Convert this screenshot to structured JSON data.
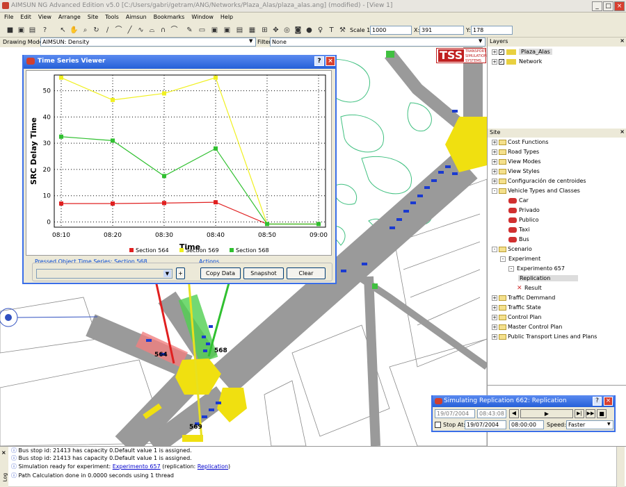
{
  "window": {
    "title": "AIMSUN NG Advanced Edition v5.0  [C:/Users/gabri/getram/ANG/Networks/Plaza_Alas/plaza_alas.ang] (modified) - [View 1]"
  },
  "menu": [
    "File",
    "Edit",
    "View",
    "Arrange",
    "Site",
    "Tools",
    "Aimsun",
    "Bookmarks",
    "Window",
    "Help"
  ],
  "toolbar": {
    "scale_label": "Scale 1:",
    "scale_value": "1000",
    "x_label": "X:",
    "x_value": "391",
    "y_label": "Y:",
    "y_value": "178"
  },
  "drawing_mode": {
    "label": "Drawing Mode:",
    "value": "AIMSUN: Density",
    "filter_label": "Filter:",
    "filter_value": "None"
  },
  "layers": {
    "header": "Layers",
    "items": [
      {
        "label": "Plaza_Alas",
        "checked": true
      },
      {
        "label": "Network",
        "checked": true
      }
    ]
  },
  "site": {
    "header": "Site",
    "items": [
      {
        "label": "Cost Functions",
        "level": 0,
        "pm": "+"
      },
      {
        "label": "Road Types",
        "level": 0,
        "pm": "+"
      },
      {
        "label": "View Modes",
        "level": 0,
        "pm": "+"
      },
      {
        "label": "View Styles",
        "level": 0,
        "pm": "+"
      },
      {
        "label": "Configuración de centroides",
        "level": 0,
        "pm": "+"
      },
      {
        "label": "Vehicle Types and Classes",
        "level": 0,
        "pm": "-"
      },
      {
        "label": "Car",
        "level": 2,
        "pm": ""
      },
      {
        "label": "Privado",
        "level": 2,
        "pm": ""
      },
      {
        "label": "Publico",
        "level": 2,
        "pm": ""
      },
      {
        "label": "Taxi",
        "level": 2,
        "pm": ""
      },
      {
        "label": "Bus",
        "level": 2,
        "pm": ""
      },
      {
        "label": "Scenario",
        "level": 0,
        "pm": "-"
      },
      {
        "label": "Experiment",
        "level": 1,
        "pm": "-"
      },
      {
        "label": "Experimento 657",
        "level": 2,
        "pm": "-"
      },
      {
        "label": "Replication",
        "level": 3,
        "pm": ""
      },
      {
        "label": "Result",
        "level": 3,
        "pm": ""
      },
      {
        "label": "Traffic Demmand",
        "level": 0,
        "pm": "+"
      },
      {
        "label": "Traffic State",
        "level": 0,
        "pm": "+"
      },
      {
        "label": "Control Plan",
        "level": 0,
        "pm": "+"
      },
      {
        "label": "Master Control Plan",
        "level": 0,
        "pm": "+"
      },
      {
        "label": "Public Transport Lines and Plans",
        "level": 0,
        "pm": "+"
      }
    ]
  },
  "tss_logo": {
    "big": "TSS",
    "small1": "TRANSPORT",
    "small2": "SIMULATION",
    "small3": "SYSTEMS"
  },
  "tsv": {
    "title": "Time Series Viewer",
    "pressed_label": "Pressed Object Time Series: Section 568",
    "actions_label": "Actions",
    "plus_label": "+",
    "copy_label": "Copy Data",
    "snapshot_label": "Snapshot",
    "clear_label": "Clear"
  },
  "chart_data": {
    "type": "line",
    "xlabel": "Time",
    "ylabel": "SRC Delay Time",
    "categories": [
      "08:10",
      "08:20",
      "08:30",
      "08:40",
      "08:50",
      "09:00"
    ],
    "ylim": [
      -2,
      56
    ],
    "yticks": [
      0,
      10,
      20,
      30,
      40,
      50
    ],
    "grid": true,
    "legend_position": "bottom",
    "series": [
      {
        "name": "Section 564",
        "color": "#e02020",
        "values": [
          7,
          7,
          7.2,
          7.5,
          -0.8,
          -0.8
        ]
      },
      {
        "name": "Section 569",
        "color": "#f0f020",
        "values": [
          55,
          46.5,
          49,
          55,
          -0.8,
          -0.8
        ]
      },
      {
        "name": "Section 568",
        "color": "#30c030",
        "values": [
          32.5,
          31,
          17.5,
          28,
          -0.8,
          -0.8
        ]
      }
    ]
  },
  "map_labels": {
    "s564": "564",
    "s568": "568",
    "s569": "569"
  },
  "sim": {
    "title": "Simulating Replication 662: Replication",
    "date1": "19/07/2004",
    "time1": "08:43:08",
    "stop_label": "Stop At:",
    "date2": "19/07/2004",
    "time2": "08:00:00",
    "speed_label": "Speed:",
    "speed_value": "Faster"
  },
  "log": {
    "side_label": "Log",
    "lines": [
      {
        "text": "Bus stop id: 21413 has capacity 0.Default value 1 is assigned."
      },
      {
        "text": "Bus stop id: 21413 has capacity 0.Default value 1 is assigned."
      },
      {
        "text": "Simulation ready for experiment: ",
        "link1": "Experimento 657",
        "mid": " (replication: ",
        "link2": "Replication",
        "end": ")"
      },
      {
        "text": "Path Calculation done in 0.0000 seconds using 1 thread"
      }
    ]
  }
}
